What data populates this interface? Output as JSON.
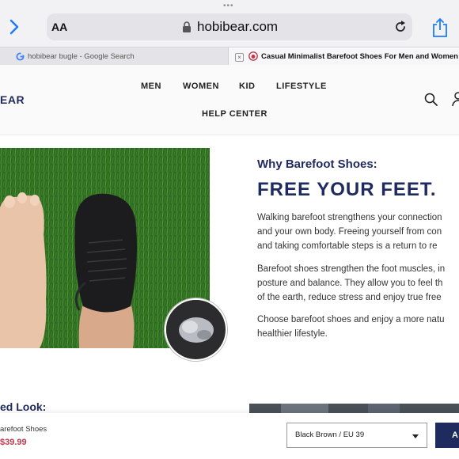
{
  "browser": {
    "text_size_button": "AA",
    "url": "hobibear.com",
    "tabs": [
      {
        "label": "hobibear bugle - Google Search",
        "active": false
      },
      {
        "label": "Casual Minimalist Barefoot Shoes For Men and Women - E",
        "active": true
      }
    ]
  },
  "site": {
    "logo": "EAR",
    "nav": [
      "MEN",
      "WOMEN",
      "KID",
      "LIFESTYLE",
      "HELP CENTER"
    ],
    "brand_color": "#1f2a5e"
  },
  "hero": {
    "subhead": "Why Barefoot Shoes:",
    "headline": "FREE YOUR FEET.",
    "paragraphs": [
      [
        "Walking barefoot strengthens your connection",
        "and your own body. Freeing yourself from con",
        "and taking comfortable steps is a return to re"
      ],
      [
        "Barefoot shoes strengthen the foot muscles, in",
        "posture and balance. They allow you to feel th",
        "of the earth, reduce stress and enjoy true free"
      ],
      [
        "Choose barefoot shoes and enjoy a more natu",
        "healthier lifestyle."
      ]
    ]
  },
  "lower": {
    "title": "ed Look:"
  },
  "sticky_bar": {
    "product_name": "arefoot Shoes",
    "price": "$39.99",
    "variant": "Black Brown / EU 39",
    "add_label": "A"
  }
}
